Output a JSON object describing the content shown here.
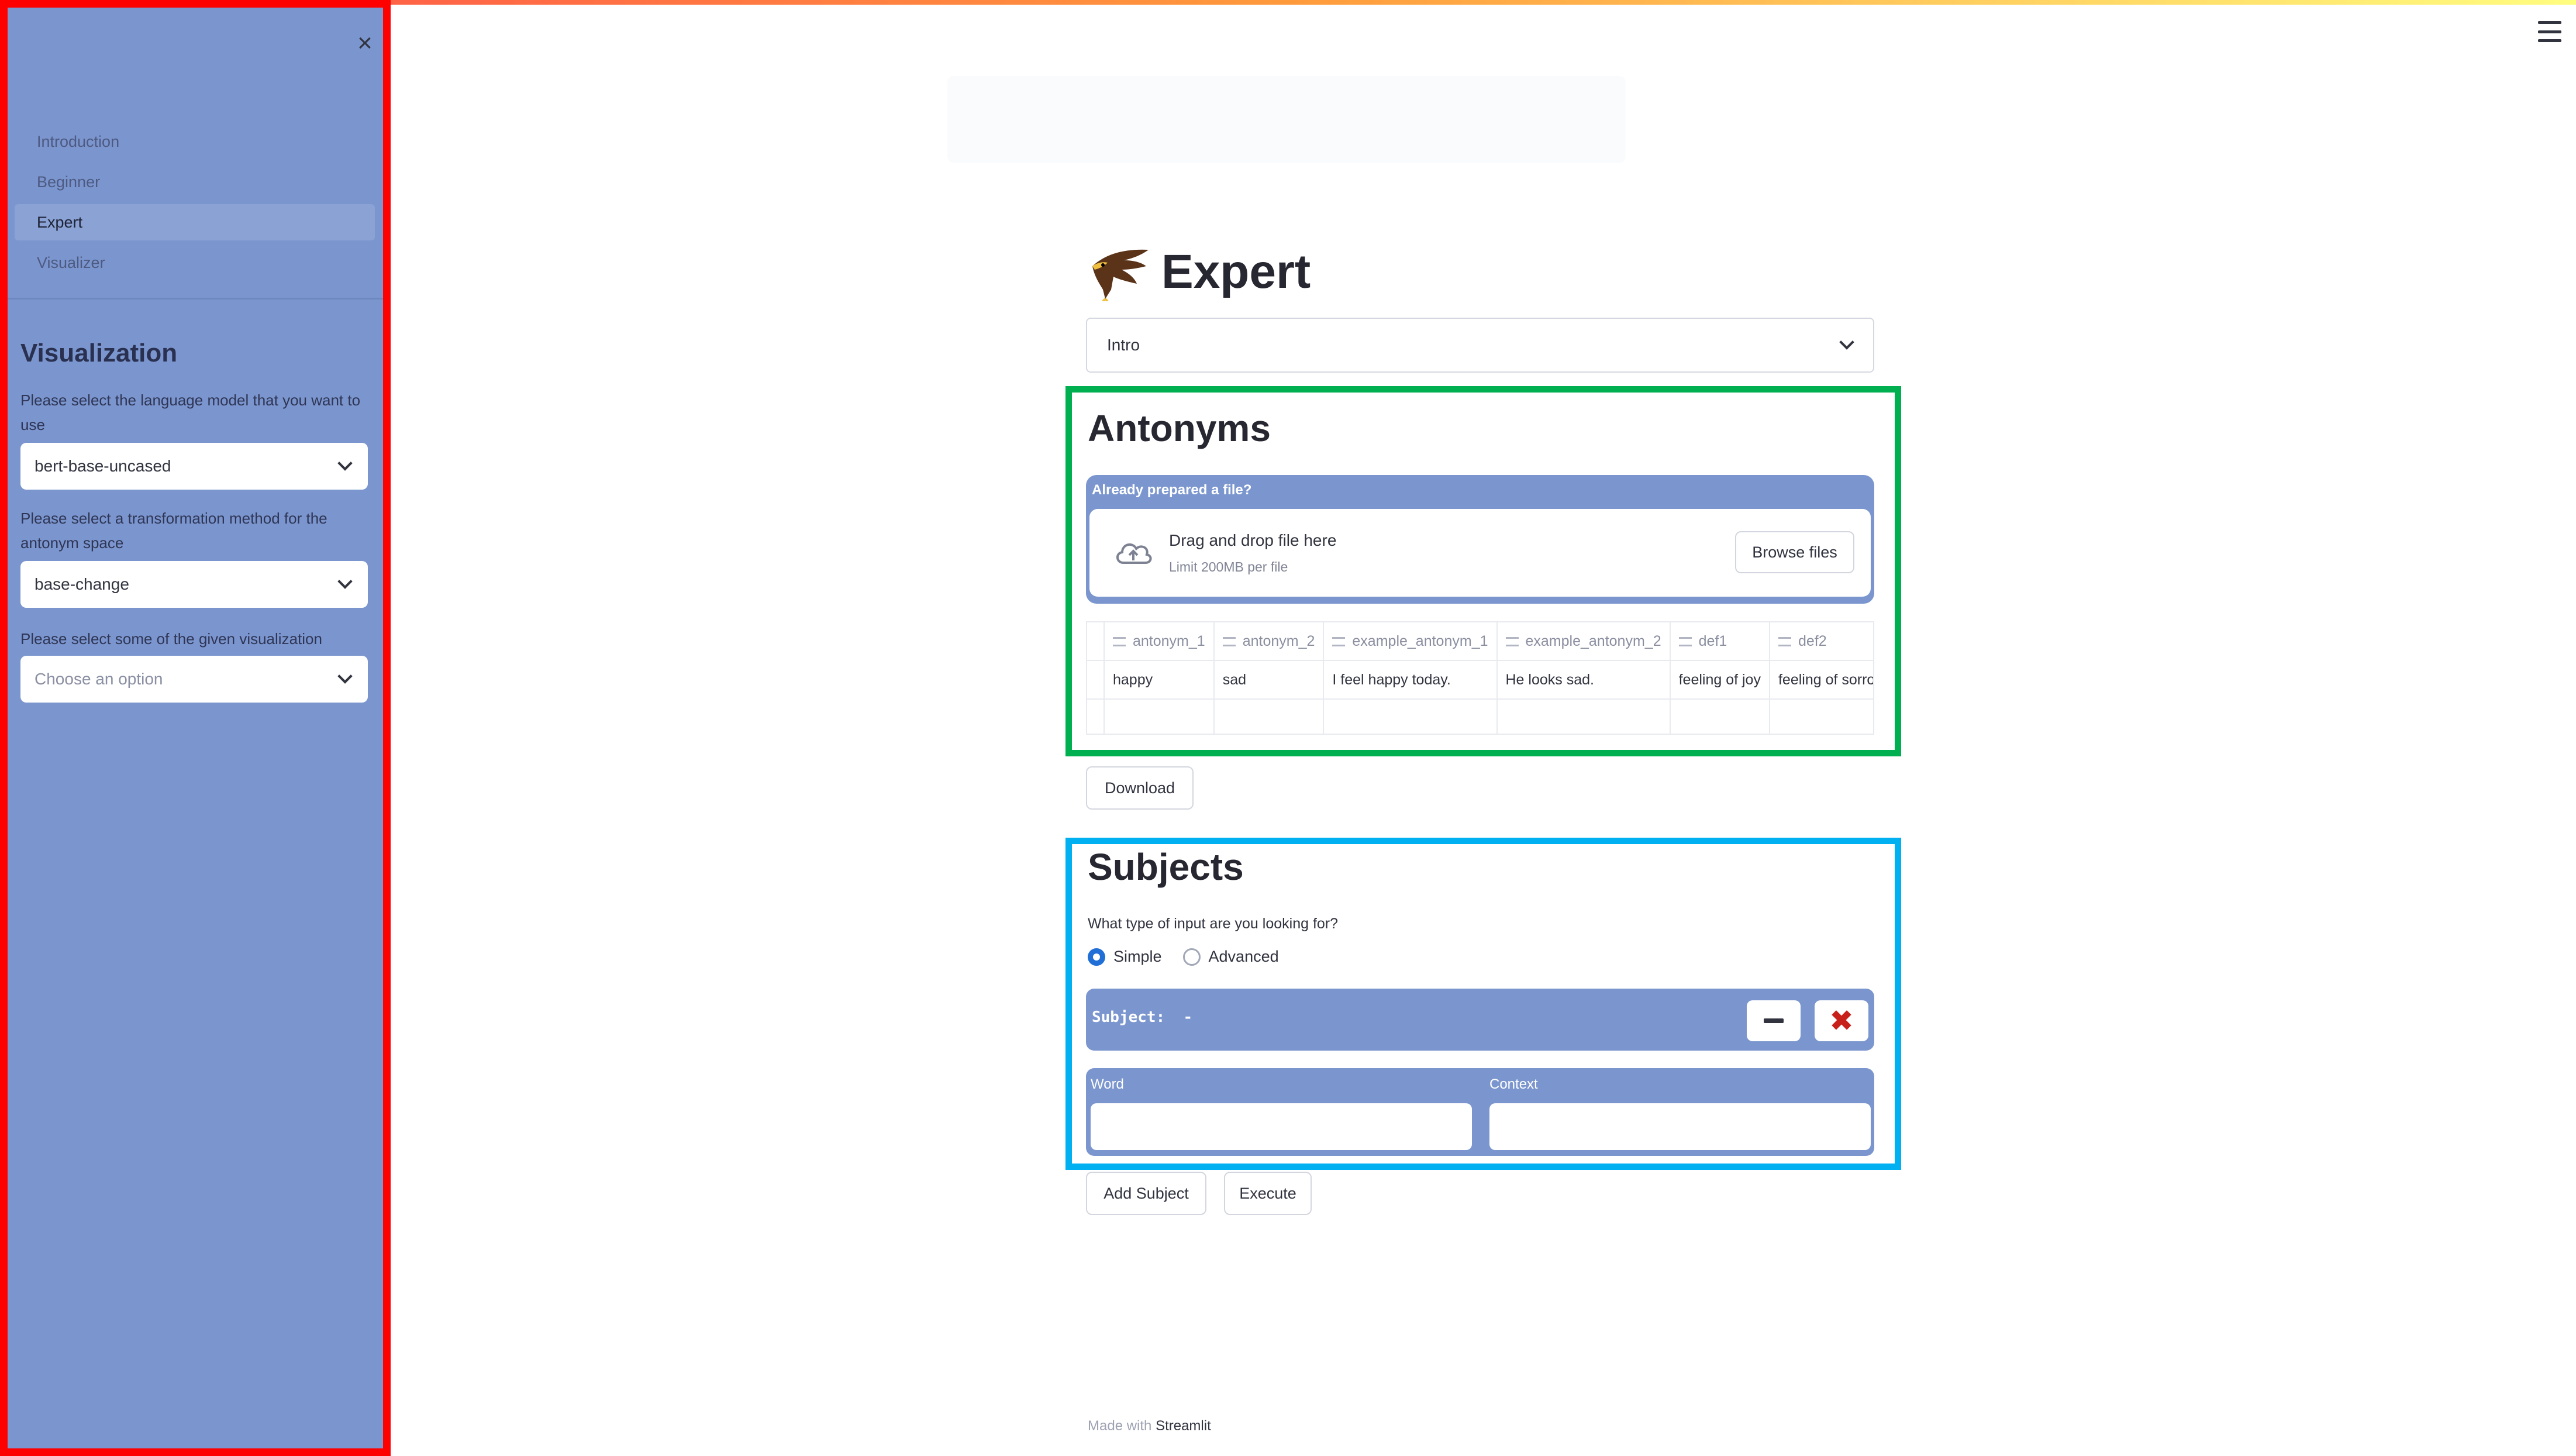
{
  "sidebar": {
    "close_glyph": "×",
    "nav": [
      {
        "label": "Introduction",
        "active": false
      },
      {
        "label": "Beginner",
        "active": false
      },
      {
        "label": "Expert",
        "active": true
      },
      {
        "label": "Visualizer",
        "active": false
      }
    ],
    "section_title": "Visualization",
    "model_label": "Please select the language model that you want to use",
    "model_value": "bert-base-uncased",
    "transform_label": "Please select a transformation method for the antonym space",
    "transform_value": "base-change",
    "options_label": "Please select some of the given visualization options",
    "options_placeholder": "Choose an option",
    "accent_color": "#7b96ce",
    "annotation_color": "#ff0000"
  },
  "page": {
    "title": "Expert",
    "page_select_value": "Intro"
  },
  "antonyms": {
    "heading": "Antonyms",
    "uploader_header": "Already prepared a file?",
    "drag_text": "Drag and drop file here",
    "limit_text": "Limit 200MB per file",
    "browse_label": "Browse files",
    "columns": [
      "antonym_1",
      "antonym_2",
      "example_antonym_1",
      "example_antonym_2",
      "def1",
      "def2"
    ],
    "rows": [
      [
        "happy",
        "sad",
        "I feel happy today.",
        "He looks sad.",
        "feeling of joy",
        "feeling of sorrow"
      ]
    ],
    "download_label": "Download",
    "annotation_color": "#00b050"
  },
  "subjects": {
    "heading": "Subjects",
    "question": "What type of input are you looking for?",
    "options": [
      {
        "label": "Simple",
        "selected": true
      },
      {
        "label": "Advanced",
        "selected": false
      }
    ],
    "subject_label": "Subject:  -",
    "word_label": "Word",
    "context_label": "Context",
    "word_value": "",
    "context_value": "",
    "add_label": "Add Subject",
    "execute_label": "Execute",
    "annotation_color": "#00b0f0"
  },
  "footer": {
    "made_with": "Made with",
    "brand": "Streamlit"
  }
}
